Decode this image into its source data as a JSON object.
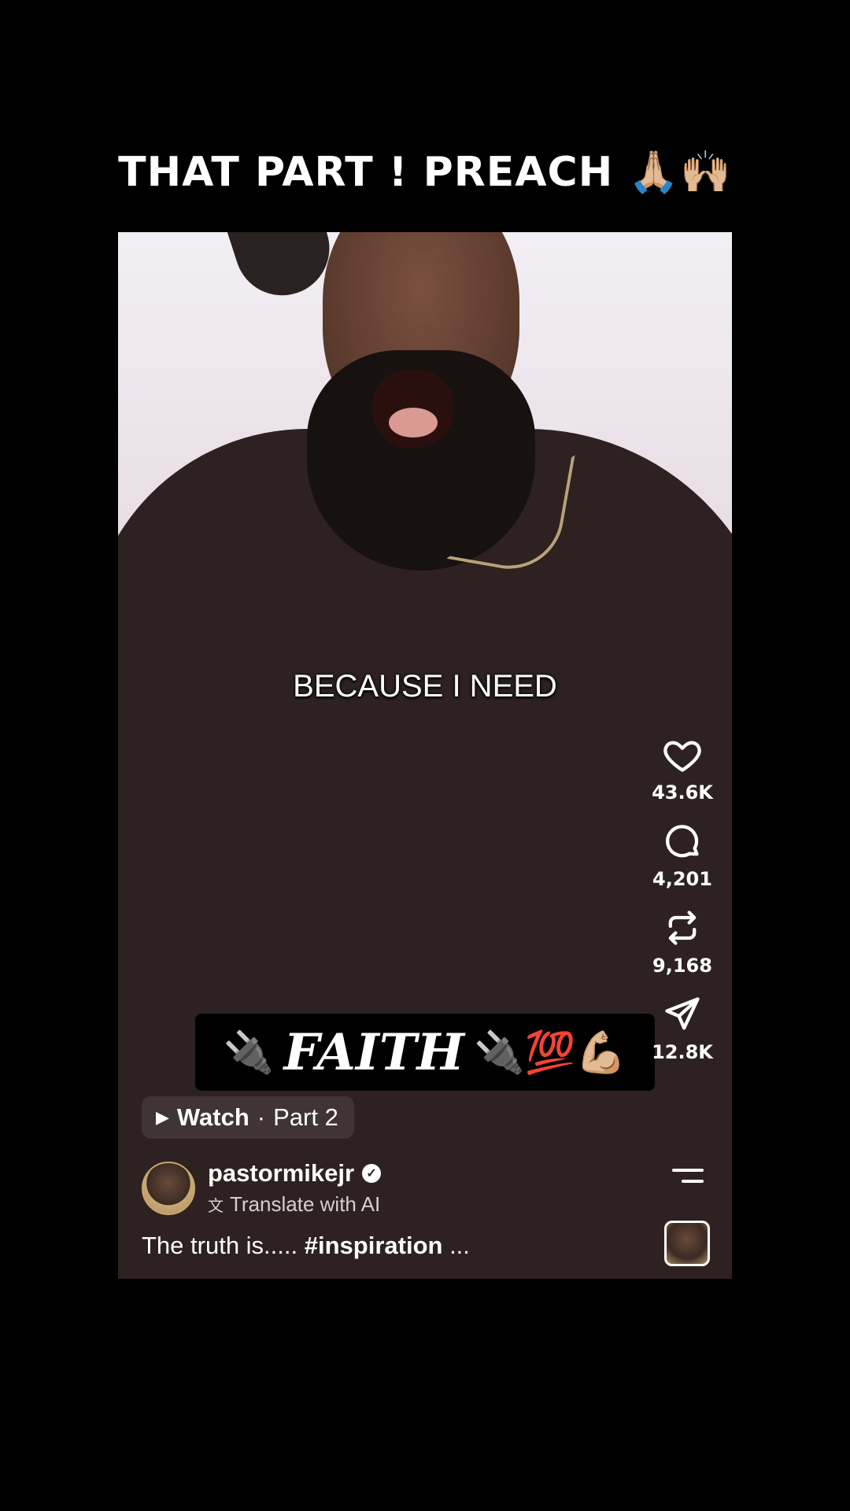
{
  "top_caption": "THAT PART ! PREACH 🙏🏼🙌🏼",
  "video": {
    "subtitle": "BECAUSE I NEED",
    "banner": {
      "prefix_emoji": "🔌",
      "text": "FAITH",
      "suffix_emoji": "🔌💯💪🏼"
    },
    "watch": {
      "label": "Watch",
      "separator": " · ",
      "part": "Part 2"
    },
    "user": {
      "username": "pastormikejr",
      "verified_icon": "verified-badge-icon",
      "translate_label": "Translate with AI"
    },
    "description": {
      "text": "The truth is..... ",
      "hashtag": "#inspiration",
      "more": " ..."
    },
    "actions": {
      "likes": "43.6K",
      "comments": "4,201",
      "reposts": "9,168",
      "shares": "12.8K"
    }
  }
}
